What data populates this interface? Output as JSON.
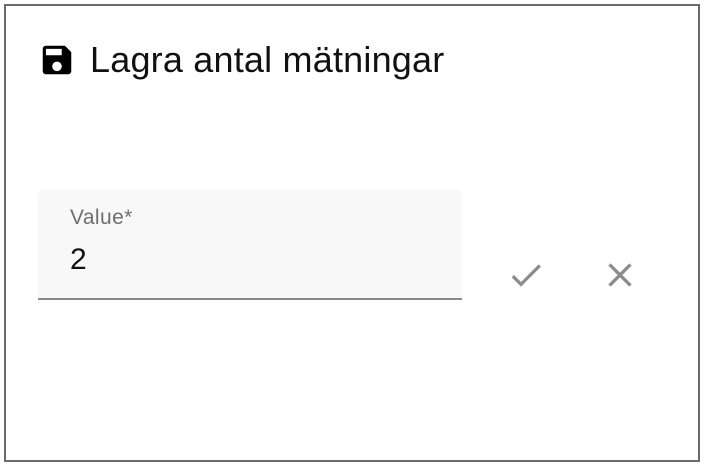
{
  "dialog": {
    "title": "Lagra antal mätningar",
    "title_icon": "save-icon"
  },
  "field": {
    "label": "Value*",
    "value": "2"
  },
  "actions": {
    "confirm_icon": "check-icon",
    "cancel_icon": "close-icon"
  },
  "colors": {
    "frame_border": "#6b6b6b",
    "field_background": "#f8f8f8",
    "field_underline": "#8a8a8a",
    "icon_gray": "#8c8c8c",
    "text_primary": "#111111"
  }
}
